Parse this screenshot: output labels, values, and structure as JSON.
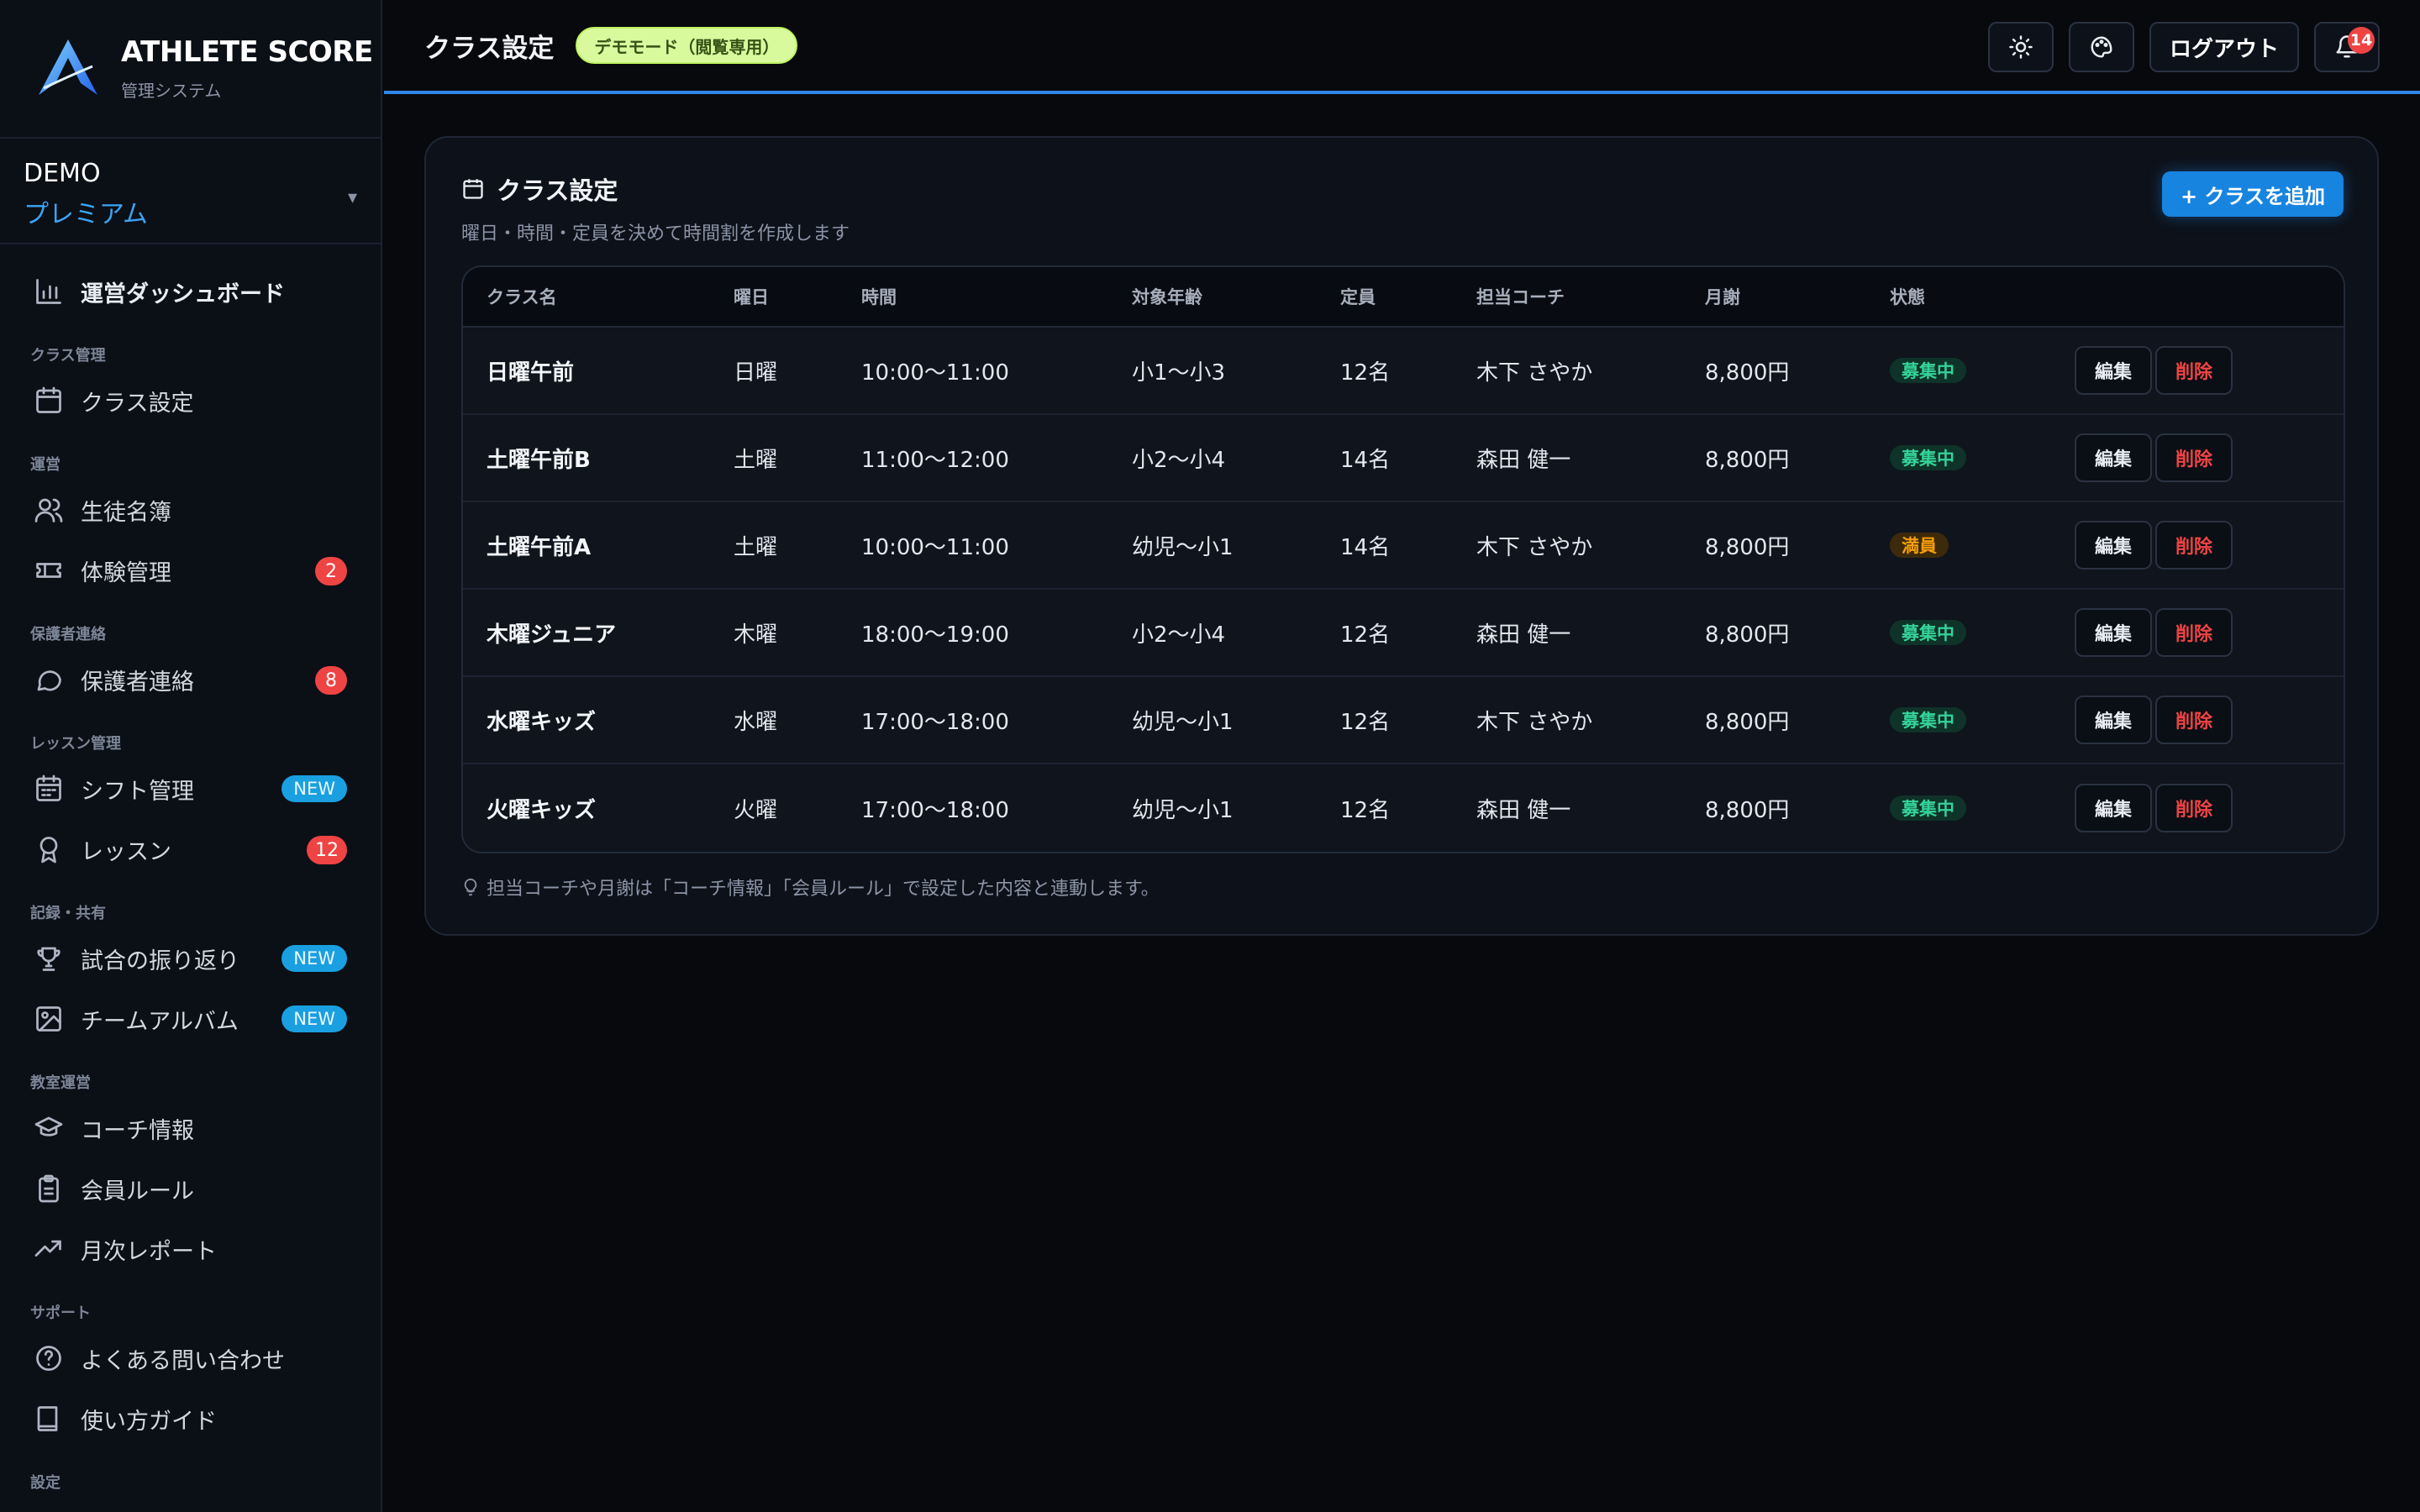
{
  "brand": {
    "name": "ATHLETE SCORE",
    "subtitle": "管理システム"
  },
  "account": {
    "name": "DEMO",
    "plan": "プレミアム"
  },
  "sidebar": {
    "dashboard": "運営ダッシュボード",
    "sections": {
      "class_mgmt": "クラス管理",
      "operations": "運営",
      "guardian": "保護者連絡",
      "lesson_mgmt": "レッスン管理",
      "records": "記録・共有",
      "school_ops": "教室運営",
      "support": "サポート",
      "settings": "設定"
    },
    "items": {
      "class_settings": "クラス設定",
      "students": "生徒名簿",
      "trial": "体験管理",
      "trial_badge": "2",
      "guardian_contact": "保護者連絡",
      "guardian_badge": "8",
      "shift": "シフト管理",
      "shift_badge": "NEW",
      "lesson": "レッスン",
      "lesson_badge": "12",
      "match_review": "試合の振り返り",
      "match_badge": "NEW",
      "album": "チームアルバム",
      "album_badge": "NEW",
      "coach": "コーチ情報",
      "rules": "会員ルール",
      "report": "月次レポート",
      "faq": "よくある問い合わせ",
      "guide": "使い方ガイド"
    }
  },
  "header": {
    "title": "クラス設定",
    "demo_badge": "デモモード（閲覧専用）",
    "logout": "ログアウト",
    "notifications": "14"
  },
  "card": {
    "title": "クラス設定",
    "subtitle": "曜日・時間・定員を決めて時間割を作成します",
    "add_button": "+ クラスを追加",
    "note": "担当コーチや月謝は「コーチ情報」「会員ルール」で設定した内容と連動します。"
  },
  "table": {
    "headers": [
      "クラス名",
      "曜日",
      "時間",
      "対象年齢",
      "定員",
      "担当コーチ",
      "月謝",
      "状態"
    ],
    "edit_label": "編集",
    "delete_label": "削除",
    "rows": [
      {
        "name": "日曜午前",
        "day": "日曜",
        "time": "10:00〜11:00",
        "age": "小1〜小3",
        "capacity": "12名",
        "coach": "木下 さやか",
        "fee": "8,800円",
        "status": "募集中"
      },
      {
        "name": "土曜午前B",
        "day": "土曜",
        "time": "11:00〜12:00",
        "age": "小2〜小4",
        "capacity": "14名",
        "coach": "森田 健一",
        "fee": "8,800円",
        "status": "募集中"
      },
      {
        "name": "土曜午前A",
        "day": "土曜",
        "time": "10:00〜11:00",
        "age": "幼児〜小1",
        "capacity": "14名",
        "coach": "木下 さやか",
        "fee": "8,800円",
        "status": "満員"
      },
      {
        "name": "木曜ジュニア",
        "day": "木曜",
        "time": "18:00〜19:00",
        "age": "小2〜小4",
        "capacity": "12名",
        "coach": "森田 健一",
        "fee": "8,800円",
        "status": "募集中"
      },
      {
        "name": "水曜キッズ",
        "day": "水曜",
        "time": "17:00〜18:00",
        "age": "幼児〜小1",
        "capacity": "12名",
        "coach": "木下 さやか",
        "fee": "8,800円",
        "status": "募集中"
      },
      {
        "name": "火曜キッズ",
        "day": "火曜",
        "time": "17:00〜18:00",
        "age": "幼児〜小1",
        "capacity": "12名",
        "coach": "森田 健一",
        "fee": "8,800円",
        "status": "募集中"
      }
    ]
  },
  "colors": {
    "accent": "#1784e0",
    "open": "#34d399",
    "full": "#f59e0b",
    "danger": "#ef4444"
  }
}
